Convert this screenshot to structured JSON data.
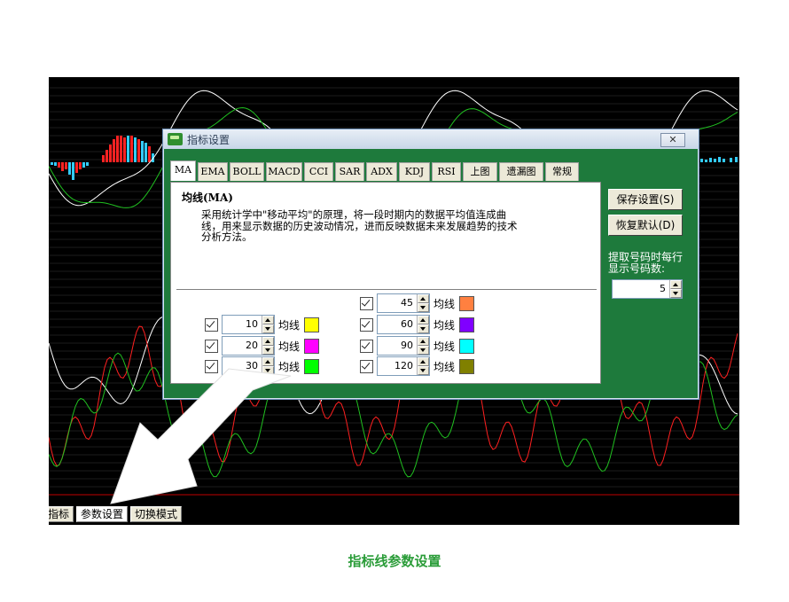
{
  "screen_tabs": [
    "指标",
    "参数设置",
    "切换模式"
  ],
  "dialog": {
    "title": "指标设置",
    "close_glyph": "✕",
    "tabs": [
      "MA",
      "EMA",
      "BOLL",
      "MACD",
      "CCI",
      "SAR",
      "ADX",
      "KDJ",
      "RSI",
      "上图",
      "遗漏图",
      "常规"
    ],
    "active_tab": "MA",
    "panel_title": "均线(MA)",
    "description": "采用统计学中\"移动平均\"的原理，将一段时期内的数据平均值连成曲线，用来显示数据的历史波动情况，进而反映数据未来发展趋势的技术分析方法。",
    "ma_left": [
      {
        "period": "10",
        "label": "均线",
        "color": "#ffff00"
      },
      {
        "period": "20",
        "label": "均线",
        "color": "#ff00ff"
      },
      {
        "period": "30",
        "label": "均线",
        "color": "#00ff00"
      }
    ],
    "ma_right": [
      {
        "period": "45",
        "label": "均线",
        "color": "#ff8040"
      },
      {
        "period": "60",
        "label": "均线",
        "color": "#8000ff"
      },
      {
        "period": "90",
        "label": "均线",
        "color": "#00ffff"
      },
      {
        "period": "120",
        "label": "均线",
        "color": "#808000"
      }
    ],
    "save_button": "保存设置(S)",
    "restore_button": "恢复默认(D)",
    "count_label": "提取号码时每行显示号码数:",
    "count_value": "5"
  },
  "caption": "指标线参数设置",
  "colors": {
    "dialog_bg": "#1e7a3c",
    "caption": "#2a9c38",
    "arrow": "#ffffff"
  },
  "icons": [
    "app-logo-icon",
    "close-icon",
    "checkbox-checked-icon",
    "spin-up-icon",
    "spin-down-icon",
    "arrow-pointer-icon"
  ]
}
